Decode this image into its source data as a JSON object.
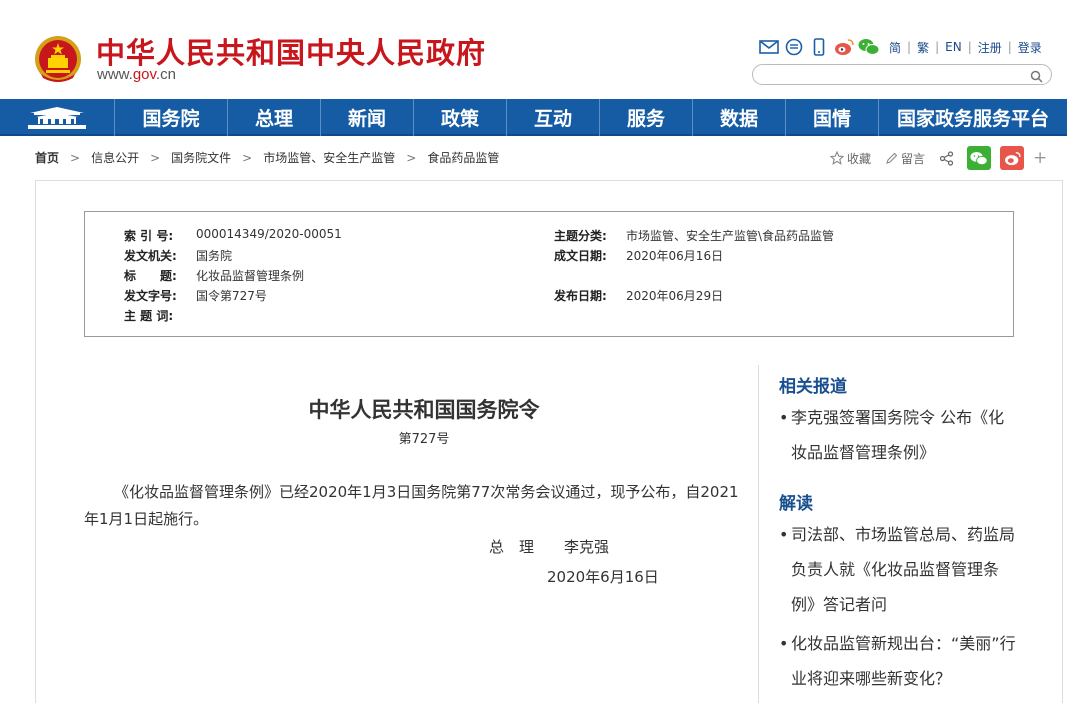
{
  "header": {
    "site_title": "中华人民共和国中央人民政府",
    "site_url_prefix": "www.",
    "site_url_domain": "gov",
    "site_url_suffix": ".cn",
    "lang_simplified": "简",
    "lang_traditional": "繁",
    "lang_english": "EN",
    "register": "注册",
    "login": "登录",
    "search_placeholder": ""
  },
  "nav": {
    "items": [
      "国务院",
      "总理",
      "新闻",
      "政策",
      "互动",
      "服务",
      "数据",
      "国情",
      "国家政务服务平台"
    ]
  },
  "breadcrumb": {
    "items": [
      "首页",
      "信息公开",
      "国务院文件",
      "市场监管、安全生产监管",
      "食品药品监管"
    ]
  },
  "share": {
    "favorite": "收藏",
    "comment": "留言"
  },
  "info": {
    "index_label": "索 引 号:",
    "index_value": "000014349/2020-00051",
    "topic_label": "主题分类:",
    "topic_value": "市场监管、安全生产监管\\食品药品监管",
    "issuer_label": "发文机关:",
    "issuer_value": "国务院",
    "date_written_label": "成文日期:",
    "date_written_value": "2020年06月16日",
    "title_label": "标　　题:",
    "title_value": "化妆品监督管理条例",
    "doc_no_label": "发文字号:",
    "doc_no_value": "国令第727号",
    "publish_label": "发布日期:",
    "publish_value": "2020年06月29日",
    "keywords_label": "主 题 词:",
    "keywords_value": ""
  },
  "document": {
    "title": "中华人民共和国国务院令",
    "number": "第727号",
    "body": "《化妆品监督管理条例》已经2020年1月3日国务院第77次常务会议通过，现予公布，自2021年1月1日起施行。",
    "signature_title": "总　理　　李克强",
    "signature_date": "2020年6月16日"
  },
  "sidebar": {
    "related_heading": "相关报道",
    "related_items": [
      "李克强签署国务院令 公布《化妆品监督管理条例》"
    ],
    "interpret_heading": "解读",
    "interpret_items": [
      "司法部、市场监管总局、药监局负责人就《化妆品监督管理条例》答记者问",
      "化妆品监管新规出台：“美丽”行业将迎来哪些新变化？"
    ]
  },
  "colors": {
    "brand_red": "#c8161d",
    "nav_blue": "#155ca5",
    "heading_blue": "#1a4f8f",
    "wechat_green": "#3cb034",
    "weibo_orange": "#e8554b"
  }
}
